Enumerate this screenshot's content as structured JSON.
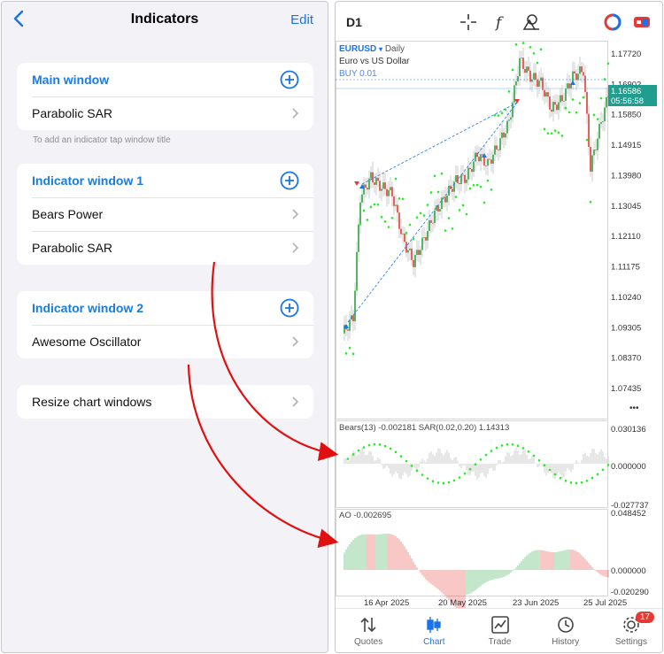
{
  "left": {
    "nav": {
      "title": "Indicators",
      "edit": "Edit"
    },
    "groups": [
      {
        "header": "Main window",
        "items": [
          "Parabolic SAR"
        ]
      },
      {
        "header": "Indicator window 1",
        "items": [
          "Bears Power",
          "Parabolic SAR"
        ]
      },
      {
        "header": "Indicator window 2",
        "items": [
          "Awesome Oscillator"
        ]
      },
      {
        "items": [
          "Resize chart windows"
        ]
      }
    ],
    "hint": "To add an indicator tap window title"
  },
  "right": {
    "timeframe": "D1",
    "symbol": "EURUSD",
    "period": "Daily",
    "description": "Euro vs US Dollar",
    "trade_label": "BUY 0.01",
    "price_axis": [
      "1.17720",
      "1.16902",
      "1.15850",
      "1.14915",
      "1.13980",
      "1.13045",
      "1.12110",
      "1.11175",
      "1.10240",
      "1.09305",
      "1.08370",
      "1.07435"
    ],
    "current_price": "1.16586",
    "countdown": "05:56:58",
    "more_dots": "•••",
    "bears": {
      "label": "Bears(13) -0.002181 SAR(0.02,0.20) 1.14313",
      "axis": [
        "0.030136",
        "0.000000",
        "-0.027737"
      ]
    },
    "ao": {
      "label": "AO -0.002695",
      "axis": [
        "0.048452",
        "0.000000",
        "-0.020290"
      ]
    },
    "dates": [
      "16 Apr 2025",
      "20 May 2025",
      "23 Jun 2025",
      "25 Jul 2025"
    ],
    "colors": {
      "bull": "#2aa53f",
      "bear": "#e53935",
      "sar": "#22ee22",
      "accent": "#1a73e8",
      "price_tag": "#1f9e8f"
    },
    "tabs": [
      {
        "label": "Quotes",
        "icon": "quotes-arrows-icon"
      },
      {
        "label": "Chart",
        "icon": "candles-icon"
      },
      {
        "label": "Trade",
        "icon": "trade-chart-icon"
      },
      {
        "label": "History",
        "icon": "history-clock-icon"
      },
      {
        "label": "Settings",
        "icon": "gear-icon",
        "badge": "17"
      }
    ]
  }
}
